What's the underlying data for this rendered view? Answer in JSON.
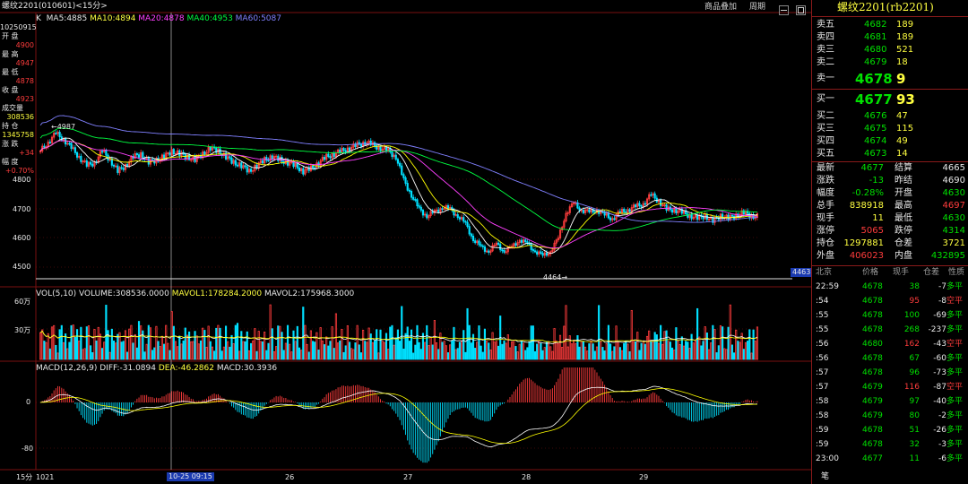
{
  "header": {
    "symbol_label": "螺纹2201(010601)<15分>",
    "buttons": [
      "商品叠加",
      "周期"
    ],
    "icon_buttons": [
      "icon-button-1",
      "icon-button-2",
      "icon-button-3"
    ]
  },
  "ma_legend": {
    "k": "K",
    "ma5": "MA5:4885",
    "ma10": "MA10:4894",
    "ma20": "MA20:4878",
    "ma40": "MA40:4953",
    "ma60": "MA60:5087"
  },
  "left_info": {
    "date": "10250915",
    "items": [
      {
        "label": "开 盘",
        "value": "4900",
        "color": "red"
      },
      {
        "label": "最 高",
        "value": "4947",
        "color": "red"
      },
      {
        "label": "最 低",
        "value": "4878",
        "color": "red"
      },
      {
        "label": "收 盘",
        "value": "4923",
        "color": "red"
      },
      {
        "label": "成交量",
        "value": "308536",
        "color": "yellow"
      },
      {
        "label": "持 仓",
        "value": "1345758",
        "color": "yellow"
      },
      {
        "label": "涨 跌",
        "value": "+34",
        "color": "red"
      },
      {
        "label": "幅 度",
        "value": "+0.70%",
        "color": "red"
      }
    ]
  },
  "price_axis": [
    "4800",
    "4700",
    "4600",
    "4500"
  ],
  "price_annotations": {
    "high_label": "4987",
    "low_label": "4464",
    "cursor_price": "4463"
  },
  "volume_legend": {
    "vol": "VOL(5,10) VOLUME:308536.0000",
    "mavol1": "MAVOL1:178284.2000",
    "mavol2": "MAVOL2:175968.3000"
  },
  "volume_axis": [
    "60万",
    "30万"
  ],
  "macd_legend": {
    "macd_name": "MACD(12,26,9)",
    "diff": "DIFF:-31.0894",
    "dea": "DEA:-46.2862",
    "macd": "MACD:30.3936"
  },
  "macd_axis": [
    "0",
    "-80"
  ],
  "time_axis": {
    "period": "15分",
    "start": "1021",
    "cursor": "10-25 09:15",
    "ticks": [
      "26",
      "27",
      "28",
      "29"
    ]
  },
  "quote": {
    "title": "螺纹2201(rb2201)",
    "asks": [
      {
        "label": "卖五",
        "price": "4682",
        "vol": "189"
      },
      {
        "label": "卖四",
        "price": "4681",
        "vol": "189"
      },
      {
        "label": "卖三",
        "price": "4680",
        "vol": "521"
      },
      {
        "label": "卖二",
        "price": "4679",
        "vol": "18"
      }
    ],
    "ask1": {
      "label": "卖一",
      "price": "4678",
      "vol": "9"
    },
    "bid1": {
      "label": "买一",
      "price": "4677",
      "vol": "93"
    },
    "bids": [
      {
        "label": "买二",
        "price": "4676",
        "vol": "47"
      },
      {
        "label": "买三",
        "price": "4675",
        "vol": "115"
      },
      {
        "label": "买四",
        "price": "4674",
        "vol": "49"
      },
      {
        "label": "买五",
        "price": "4673",
        "vol": "14"
      }
    ],
    "stats": [
      {
        "l1": "最新",
        "v1": "4677",
        "c1": "green",
        "l2": "结算",
        "v2": "4665",
        "c2": "white"
      },
      {
        "l1": "涨跌",
        "v1": "-13",
        "c1": "green",
        "l2": "昨结",
        "v2": "4690",
        "c2": "white"
      },
      {
        "l1": "幅度",
        "v1": "-0.28%",
        "c1": "green",
        "l2": "开盘",
        "v2": "4630",
        "c2": "green"
      },
      {
        "l1": "总手",
        "v1": "838918",
        "c1": "yellow",
        "l2": "最高",
        "v2": "4697",
        "c2": "red"
      },
      {
        "l1": "现手",
        "v1": "11",
        "c1": "yellow",
        "l2": "最低",
        "v2": "4630",
        "c2": "green"
      },
      {
        "l1": "涨停",
        "v1": "5065",
        "c1": "red",
        "l2": "跌停",
        "v2": "4314",
        "c2": "green"
      },
      {
        "l1": "持仓",
        "v1": "1297881",
        "c1": "yellow",
        "l2": "仓差",
        "v2": "3721",
        "c2": "yellow"
      },
      {
        "l1": "外盘",
        "v1": "406023",
        "c1": "red",
        "l2": "内盘",
        "v2": "432895",
        "c2": "green"
      }
    ],
    "trades_header": [
      "北京",
      "价格",
      "现手",
      "仓差",
      "性质"
    ],
    "trades": [
      {
        "time": "22:59",
        "price": "4678",
        "vol": "38",
        "vc": "green",
        "chg": "-7",
        "type": "多平",
        "tc": "green"
      },
      {
        "time": ":54",
        "price": "4678",
        "vol": "95",
        "vc": "red",
        "chg": "-8",
        "type": "空平",
        "tc": "red"
      },
      {
        "time": ":55",
        "price": "4678",
        "vol": "100",
        "vc": "green",
        "chg": "-69",
        "type": "多平",
        "tc": "green"
      },
      {
        "time": ":55",
        "price": "4678",
        "vol": "268",
        "vc": "green",
        "chg": "-237",
        "type": "多平",
        "tc": "green"
      },
      {
        "time": ":56",
        "price": "4680",
        "vol": "162",
        "vc": "red",
        "chg": "-43",
        "type": "空平",
        "tc": "red"
      },
      {
        "time": ":56",
        "price": "4678",
        "vol": "67",
        "vc": "green",
        "chg": "-60",
        "type": "多平",
        "tc": "green"
      },
      {
        "time": ":57",
        "price": "4678",
        "vol": "96",
        "vc": "green",
        "chg": "-73",
        "type": "多平",
        "tc": "green"
      },
      {
        "time": ":57",
        "price": "4679",
        "vol": "116",
        "vc": "red",
        "chg": "-87",
        "type": "空平",
        "tc": "red"
      },
      {
        "time": ":58",
        "price": "4679",
        "vol": "97",
        "vc": "green",
        "chg": "-40",
        "type": "多平",
        "tc": "green"
      },
      {
        "time": ":58",
        "price": "4679",
        "vol": "80",
        "vc": "green",
        "chg": "-2",
        "type": "多平",
        "tc": "green"
      },
      {
        "time": ":59",
        "price": "4678",
        "vol": "51",
        "vc": "green",
        "chg": "-26",
        "type": "多平",
        "tc": "green"
      },
      {
        "time": ":59",
        "price": "4678",
        "vol": "32",
        "vc": "green",
        "chg": "-3",
        "type": "多平",
        "tc": "green"
      },
      {
        "time": "23:00",
        "price": "4677",
        "vol": "11",
        "vc": "green",
        "chg": "-6",
        "type": "多平",
        "tc": "green"
      }
    ],
    "footer": "笔"
  },
  "colors": {
    "up": "#ff3c3c",
    "down": "#00e0ff",
    "ma5": "#ffffff",
    "ma10": "#ffff00",
    "ma20": "#ff40ff",
    "ma40": "#00ff40",
    "ma60": "#8080ff",
    "grid": "#7a1010"
  },
  "chart_data": {
    "type": "candlestick",
    "x_ticks": [
      "1021",
      "10-25 09:15",
      "26",
      "27",
      "28",
      "29"
    ],
    "price_ylim": [
      4464,
      4987
    ],
    "price_ticks": [
      4800,
      4700,
      4600,
      4500
    ],
    "close_series": [
      4900,
      4930,
      4960,
      4940,
      4910,
      4880,
      4850,
      4860,
      4900,
      4870,
      4830,
      4850,
      4880,
      4890,
      4860,
      4870,
      4880,
      4900,
      4890,
      4880,
      4870,
      4890,
      4910,
      4900,
      4880,
      4860,
      4850,
      4830,
      4850,
      4870,
      4880,
      4870,
      4860,
      4850,
      4830,
      4840,
      4860,
      4880,
      4890,
      4900,
      4910,
      4920,
      4930,
      4920,
      4910,
      4900,
      4880,
      4800,
      4750,
      4700,
      4680,
      4690,
      4710,
      4700,
      4680,
      4650,
      4600,
      4570,
      4560,
      4580,
      4560,
      4570,
      4600,
      4580,
      4560,
      4540,
      4560,
      4600,
      4690,
      4720,
      4700,
      4690,
      4700,
      4680,
      4670,
      4690,
      4700,
      4710,
      4720,
      4750,
      4730,
      4700,
      4700,
      4690,
      4680,
      4670,
      4680,
      4660,
      4680,
      4670,
      4680,
      4690,
      4677
    ],
    "volume_ylim": [
      0,
      600000
    ],
    "macd_ylim": [
      -120,
      60
    ]
  }
}
